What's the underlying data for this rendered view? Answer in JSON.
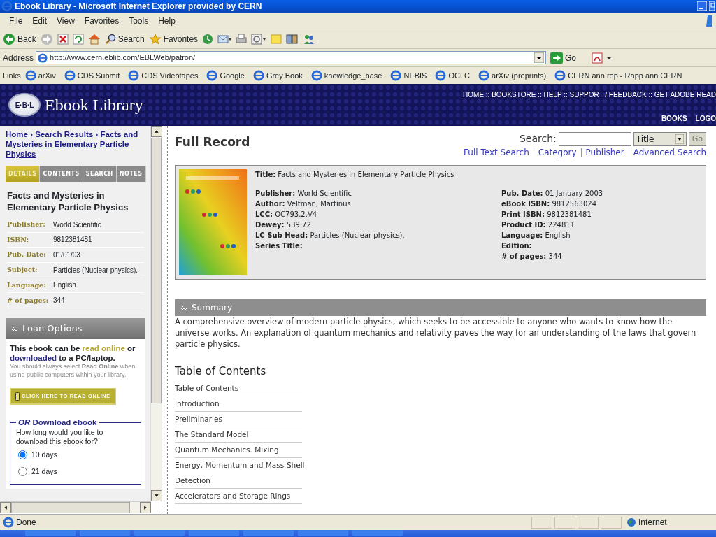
{
  "window": {
    "title": "Ebook Library - Microsoft Internet Explorer provided by CERN"
  },
  "menu": [
    "File",
    "Edit",
    "View",
    "Favorites",
    "Tools",
    "Help"
  ],
  "toolbar": [
    {
      "kind": "back",
      "label": "Back"
    },
    {
      "kind": "forward"
    },
    {
      "kind": "stop"
    },
    {
      "kind": "refresh"
    },
    {
      "kind": "home"
    },
    {
      "kind": "search",
      "label": "Search"
    },
    {
      "kind": "favorites",
      "label": "Favorites"
    },
    {
      "kind": "history"
    },
    {
      "kind": "mail"
    },
    {
      "kind": "print"
    },
    {
      "kind": "edit"
    },
    {
      "kind": "note"
    },
    {
      "kind": "research"
    },
    {
      "kind": "messenger"
    }
  ],
  "address": {
    "label": "Address",
    "value": "http://www.cern.eblib.com/EBLWeb/patron/",
    "go": "Go"
  },
  "links": {
    "label": "Links",
    "items": [
      "arXiv",
      "CDS Submit",
      "CDS Videotapes",
      "Google",
      "Grey Book",
      "knowledge_base",
      "NEBIS",
      "OCLC",
      "arXiv (preprints)",
      "CERN ann rep - Rapp ann CERN"
    ]
  },
  "site": {
    "badge": "E·B·L",
    "name": "Ebook Library",
    "top_links": "HOME :: BOOKSTORE :: HELP :: SUPPORT / FEEDBACK :: GET ADOBE READ",
    "nav": [
      "BOOKS",
      "LOGO"
    ]
  },
  "sidebar": {
    "breadcrumb": [
      {
        "kind": "link",
        "text": "Home"
      },
      {
        "kind": "sep",
        "text": "›"
      },
      {
        "kind": "link",
        "text": "Search Results"
      },
      {
        "kind": "sep",
        "text": "›"
      },
      {
        "kind": "link",
        "text": "Facts and Mysteries in Elementary Particle Physics"
      }
    ],
    "tabs": [
      {
        "label": "DETAILS",
        "selected": true
      },
      {
        "label": "CONTENTS",
        "selected": false
      },
      {
        "label": "SEARCH",
        "selected": false
      },
      {
        "label": "NOTES",
        "selected": false
      }
    ],
    "book_title": "Facts and Mysteries in Elementary Particle Physics",
    "details": [
      {
        "label": "Publisher:",
        "value": "World Scientific"
      },
      {
        "label": "ISBN:",
        "value": "9812381481"
      },
      {
        "label": "Pub. Date:",
        "value": "01/01/03"
      },
      {
        "label": "Subject:",
        "value": "Particles (Nuclear physics)."
      },
      {
        "label": "Language:",
        "value": "English"
      },
      {
        "label": "# of pages:",
        "value": "344"
      }
    ],
    "loan": {
      "title": "Loan Options",
      "intro": [
        {
          "kind": "text",
          "text": "This ebook can be "
        },
        {
          "kind": "read",
          "text": "read online"
        },
        {
          "kind": "text",
          "text": " or "
        },
        {
          "kind": "download",
          "text": "downloaded"
        },
        {
          "kind": "text",
          "text": " to a PC/laptop."
        }
      ],
      "note": "You should always select **Read Online** when using public computers within your library.",
      "read_button": "CLICK HERE TO READ ONLINE",
      "download": {
        "legend": "*OR* Download ebook",
        "question": "How long would you like to download this ebook for?",
        "options": [
          {
            "label": "10 days",
            "selected": true
          },
          {
            "label": "21 days",
            "selected": false
          }
        ]
      }
    }
  },
  "main": {
    "title": "Full Record",
    "search": {
      "label": "Search:",
      "field": "Title",
      "go": "Go",
      "links": [
        "Full Text Search",
        "Category",
        "Publisher",
        "Advanced Search"
      ]
    },
    "record": {
      "title_label": "Title:",
      "title": "Facts and Mysteries in Elementary Particle Physics",
      "left": [
        {
          "label": "Publisher:",
          "value": "World Scientific"
        },
        {
          "label": "Author:",
          "value": "Veltman, Martinus"
        },
        {
          "label": "LCC:",
          "value": "QC793.2.V4"
        },
        {
          "label": "Dewey:",
          "value": "539.72"
        },
        {
          "label": "LC Sub Head:",
          "value": "Particles (Nuclear physics)."
        },
        {
          "label": "Series Title:"
        }
      ],
      "right": [
        {
          "label": "Pub. Date:",
          "value": "01 January 2003"
        },
        {
          "label": "eBook ISBN:",
          "value": "9812563024"
        },
        {
          "label": "Print ISBN:",
          "value": "9812381481"
        },
        {
          "label": "Product ID:",
          "value": "224811"
        },
        {
          "label": "Language:",
          "value": "English"
        },
        {
          "label": "Edition:"
        },
        {
          "label": "# of pages:",
          "value": "344"
        }
      ]
    },
    "summary": {
      "heading": "Summary",
      "text": "A comprehensive overview of modern particle physics, which seeks to be accessible to anyone who wants to know how the universe works. An explanation of quantum mechanics and relativity paves the way for an understanding of the laws that govern particle physics."
    },
    "toc": {
      "heading": "Table of Contents",
      "items": [
        "Table of Contents",
        "Introduction",
        "Preliminaries",
        "The Standard Model",
        "Quantum Mechanics. Mixing",
        "Energy, Momentum and Mass-Shell",
        "Detection",
        "Accelerators and Storage Rings"
      ]
    }
  },
  "status_bar": {
    "text": "Done",
    "zone": "Internet"
  }
}
